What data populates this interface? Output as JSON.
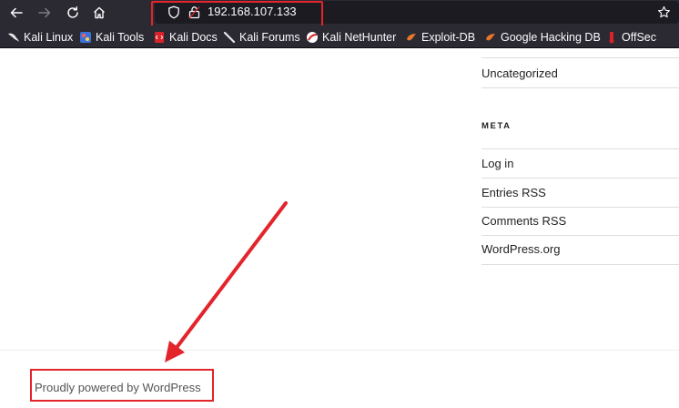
{
  "browser": {
    "url": "192.168.107.133",
    "bookmarks": [
      {
        "label": "Kali Linux",
        "icon": "kali-dragon-icon"
      },
      {
        "label": "Kali Tools",
        "icon": "kali-tools-icon"
      },
      {
        "label": "Kali Docs",
        "icon": "kali-docs-icon"
      },
      {
        "label": "Kali Forums",
        "icon": "kali-forums-icon"
      },
      {
        "label": "Kali NetHunter",
        "icon": "nethunter-icon"
      },
      {
        "label": "Exploit-DB",
        "icon": "exploit-db-icon"
      },
      {
        "label": "Google Hacking DB",
        "icon": "ghdb-icon"
      },
      {
        "label": "OffSec",
        "icon": "offsec-icon"
      }
    ],
    "colors": {
      "chrome": "#2b2a33",
      "urlbar": "#1c1b22",
      "highlight": "#e3242b"
    }
  },
  "sidebar": {
    "category_link": "Uncategorized",
    "meta_heading": "META",
    "meta_links": [
      "Log in",
      "Entries RSS",
      "Comments RSS",
      "WordPress.org"
    ]
  },
  "footer": {
    "powered_by": "Proudly powered by WordPress"
  }
}
